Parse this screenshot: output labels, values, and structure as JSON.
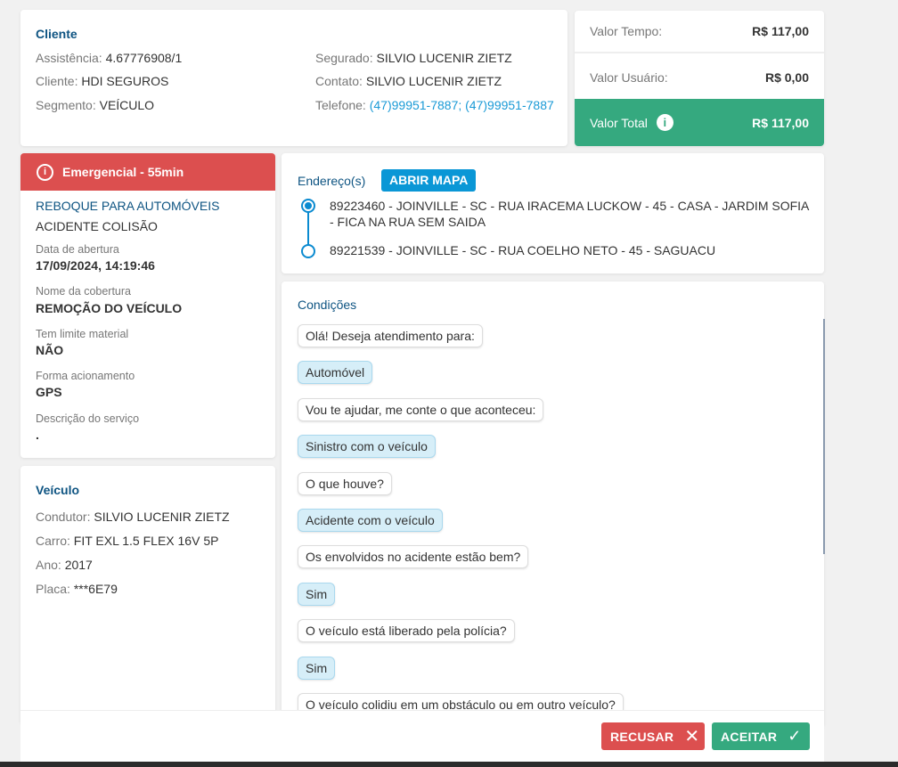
{
  "cliente": {
    "title": "Cliente",
    "assistencia_label": "Assistência:",
    "assistencia": "4.67776908/1",
    "cliente_label": "Cliente:",
    "cliente": "HDI SEGUROS",
    "segmento_label": "Segmento:",
    "segmento": "VEÍCULO",
    "segurado_label": "Segurado:",
    "segurado": "SILVIO LUCENIR ZIETZ",
    "contato_label": "Contato:",
    "contato": "SILVIO LUCENIR ZIETZ",
    "telefone_label": "Telefone:",
    "telefone": "(47)99951-7887; (47)99951-7887"
  },
  "valores": {
    "tempo_label": "Valor Tempo:",
    "tempo": "R$ 117,00",
    "usuario_label": "Valor Usuário:",
    "usuario": "R$ 0,00",
    "total_label": "Valor Total",
    "total": "R$ 117,00",
    "total_color": "#35a97f"
  },
  "servico": {
    "alert": "Emergencial - 55min",
    "alert_color": "#dc4f4f",
    "title": "REBOQUE PARA AUTOMÓVEIS",
    "subtitle": "ACIDENTE COLISÃO",
    "fields": [
      {
        "label": "Data de abertura",
        "value": "17/09/2024, 14:19:46"
      },
      {
        "label": "Nome da cobertura",
        "value": "REMOÇÃO DO VEÍCULO"
      },
      {
        "label": "Tem limite material",
        "value": "NÃO"
      },
      {
        "label": "Forma acionamento",
        "value": "GPS"
      },
      {
        "label": "Descrição do serviço",
        "value": "."
      }
    ]
  },
  "veiculo": {
    "title": "Veículo",
    "condutor_label": "Condutor:",
    "condutor": "SILVIO LUCENIR ZIETZ",
    "carro_label": "Carro:",
    "carro": "FIT EXL 1.5 FLEX 16V 5P",
    "ano_label": "Ano:",
    "ano": "2017",
    "placa_label": "Placa:",
    "placa": "***6E79"
  },
  "enderecos": {
    "title": "Endereço(s)",
    "map_button": "ABRIR MAPA",
    "items": [
      "89223460 - JOINVILLE - SC - RUA IRACEMA LUCKOW - 45 - CASA - JARDIM SOFIA - FICA NA RUA SEM SAIDA",
      "89221539 - JOINVILLE - SC - RUA COELHO NETO - 45 - SAGUACU"
    ]
  },
  "condicoes": {
    "title": "Condições",
    "messages": [
      {
        "text": "Olá! Deseja atendimento para:",
        "from": "bot"
      },
      {
        "text": "Automóvel",
        "from": "user"
      },
      {
        "text": "Vou te ajudar, me conte o que aconteceu:",
        "from": "bot"
      },
      {
        "text": "Sinistro com o veículo",
        "from": "user"
      },
      {
        "text": "O que houve?",
        "from": "bot"
      },
      {
        "text": "Acidente com o veículo",
        "from": "user"
      },
      {
        "text": "Os envolvidos no acidente estão bem?",
        "from": "bot"
      },
      {
        "text": "Sim",
        "from": "user"
      },
      {
        "text": "O veículo está liberado pela polícia?",
        "from": "bot"
      },
      {
        "text": "Sim",
        "from": "user"
      },
      {
        "text": "O veículo colidiu em um obstáculo ou em outro veículo?",
        "from": "bot"
      }
    ]
  },
  "footer": {
    "refuse": "RECUSAR",
    "accept": "ACEITAR"
  }
}
